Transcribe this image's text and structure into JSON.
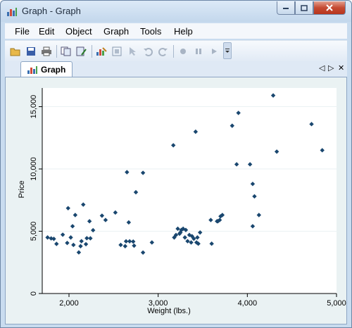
{
  "window": {
    "title": "Graph - Graph",
    "controls": {
      "minimize": "minimize-icon",
      "maximize": "maximize-icon",
      "close": "close-icon"
    }
  },
  "menu": [
    {
      "label": "File"
    },
    {
      "label": "Edit"
    },
    {
      "label": "Object"
    },
    {
      "label": "Graph"
    },
    {
      "label": "Tools"
    },
    {
      "label": "Help"
    }
  ],
  "toolbar": {
    "icons": [
      "open-icon",
      "save-icon",
      "print-icon",
      "copy-icon",
      "rename-icon",
      "graph-editor-icon",
      "record-icon",
      "pointer-icon",
      "undo-icon",
      "redo-icon",
      "record-start-icon",
      "pause-icon",
      "play-icon",
      "overflow-icon"
    ]
  },
  "tabs": [
    {
      "label": "Graph",
      "icon": "bar-chart-icon",
      "active": true
    }
  ],
  "tab_nav": {
    "prev": "◁",
    "next": "▷",
    "close": "✕"
  },
  "colors": {
    "marker": "#1a476f",
    "plot_region": "#ffffff",
    "graph_region": "#eaf2f3"
  },
  "chart_data": {
    "type": "scatter",
    "title": "",
    "xlabel": "Weight (lbs.)",
    "ylabel": "Price",
    "xlim": [
      1700,
      5000
    ],
    "ylim": [
      0,
      16500
    ],
    "xticks": [
      2000,
      3000,
      4000,
      5000
    ],
    "xtick_labels": [
      "2,000",
      "3,000",
      "4,000",
      "5,000"
    ],
    "yticks": [
      0,
      5000,
      10000,
      15000
    ],
    "ytick_labels": [
      "0",
      "5,000",
      "10,000",
      "15,000"
    ],
    "grid": "horizontal",
    "marker": "diamond",
    "points": [
      [
        1760,
        4499
      ],
      [
        1800,
        4425
      ],
      [
        1830,
        4389
      ],
      [
        1860,
        3984
      ],
      [
        1930,
        4723
      ],
      [
        1980,
        4060
      ],
      [
        1990,
        6850
      ],
      [
        2020,
        4500
      ],
      [
        2040,
        5400
      ],
      [
        2050,
        3900
      ],
      [
        2070,
        6300
      ],
      [
        2110,
        3300
      ],
      [
        2130,
        3800
      ],
      [
        2140,
        4200
      ],
      [
        2160,
        7140
      ],
      [
        2190,
        3960
      ],
      [
        2200,
        4440
      ],
      [
        2230,
        5800
      ],
      [
        2240,
        4430
      ],
      [
        2270,
        5080
      ],
      [
        2370,
        6250
      ],
      [
        2410,
        5900
      ],
      [
        2520,
        6500
      ],
      [
        2580,
        3900
      ],
      [
        2630,
        3800
      ],
      [
        2640,
        4190
      ],
      [
        2650,
        9740
      ],
      [
        2670,
        5710
      ],
      [
        2680,
        4190
      ],
      [
        2720,
        4170
      ],
      [
        2730,
        3840
      ],
      [
        2750,
        8130
      ],
      [
        2830,
        3290
      ],
      [
        2830,
        9690
      ],
      [
        2930,
        4100
      ],
      [
        3170,
        11900
      ],
      [
        3180,
        4500
      ],
      [
        3200,
        4700
      ],
      [
        3220,
        5200
      ],
      [
        3240,
        4800
      ],
      [
        3250,
        4900
      ],
      [
        3260,
        5100
      ],
      [
        3280,
        5200
      ],
      [
        3300,
        4500
      ],
      [
        3310,
        5100
      ],
      [
        3330,
        4200
      ],
      [
        3350,
        4700
      ],
      [
        3370,
        4100
      ],
      [
        3380,
        4600
      ],
      [
        3400,
        4400
      ],
      [
        3420,
        12990
      ],
      [
        3430,
        4100
      ],
      [
        3440,
        4500
      ],
      [
        3450,
        4000
      ],
      [
        3470,
        4900
      ],
      [
        3590,
        5900
      ],
      [
        3600,
        4000
      ],
      [
        3660,
        5800
      ],
      [
        3670,
        5800
      ],
      [
        3690,
        5900
      ],
      [
        3700,
        6200
      ],
      [
        3720,
        6300
      ],
      [
        3830,
        13470
      ],
      [
        3880,
        10370
      ],
      [
        3900,
        14500
      ],
      [
        4030,
        10370
      ],
      [
        4060,
        5400
      ],
      [
        4060,
        8800
      ],
      [
        4080,
        7800
      ],
      [
        4130,
        6300
      ],
      [
        4290,
        15900
      ],
      [
        4330,
        11390
      ],
      [
        4720,
        13600
      ],
      [
        4840,
        11500
      ]
    ]
  }
}
